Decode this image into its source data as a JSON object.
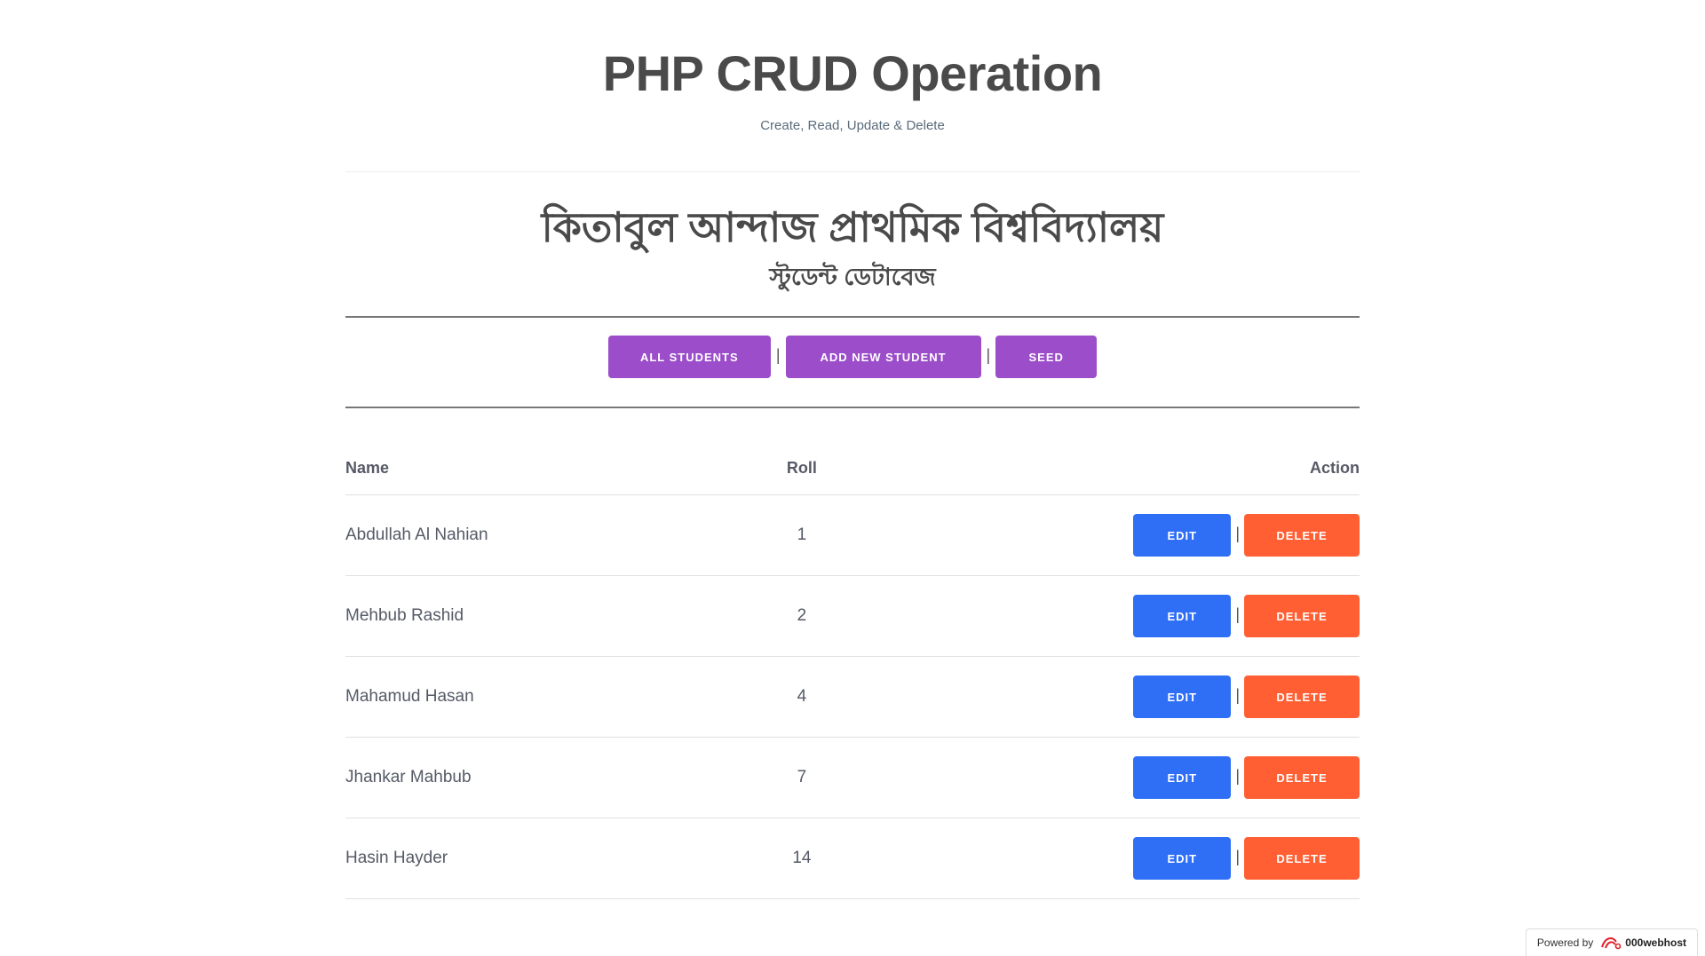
{
  "header": {
    "title": "PHP CRUD Operation",
    "tagline": "Create, Read, Update & Delete"
  },
  "institution": {
    "name": "কিতাবুল আন্দাজ প্রাথমিক বিশ্ববিদ্যালয়",
    "subtitle": "স্টুডেন্ট ডেটাবেজ"
  },
  "nav": {
    "buttons": [
      {
        "label": "ALL STUDENTS"
      },
      {
        "label": "ADD NEW STUDENT"
      },
      {
        "label": "SEED"
      }
    ],
    "separator": "|"
  },
  "colors": {
    "nav_button": "#9b4dca",
    "edit_button": "#2f6ff6",
    "delete_button": "#ff5f33"
  },
  "table": {
    "columns": {
      "name": "Name",
      "roll": "Roll",
      "action": "Action"
    },
    "rows": [
      {
        "name": "Abdullah Al Nahian",
        "roll": "1"
      },
      {
        "name": "Mehbub Rashid",
        "roll": "2"
      },
      {
        "name": "Mahamud Hasan",
        "roll": "4"
      },
      {
        "name": "Jhankar Mahbub",
        "roll": "7"
      },
      {
        "name": "Hasin Hayder",
        "roll": "14"
      }
    ],
    "edit_label": "EDIT",
    "delete_label": "DELETE",
    "action_separator": "|"
  },
  "footer": {
    "powered_by": "Powered by",
    "brand": "000webhost",
    "icon": "000webhost-logo-icon"
  }
}
